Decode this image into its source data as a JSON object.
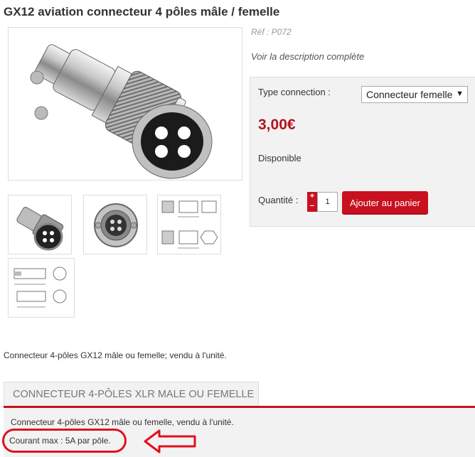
{
  "product": {
    "title": "GX12 aviation connecteur 4 pôles mâle / femelle",
    "ref": "Réf : P072",
    "description_link": "Voir la description complète"
  },
  "purchase": {
    "type_label": "Type connection :",
    "type_selected": "Connecteur femelle",
    "price": "3,00€",
    "availability": "Disponible",
    "quantity_label": "Quantité :",
    "quantity_value": "1",
    "plus": "+",
    "minus": "−",
    "add_to_cart": "Ajouter au panier"
  },
  "short_description": "Connecteur 4-pôles GX12 mâle ou femelle; vendu à l'unité.",
  "tabs": [
    {
      "label": "CONNECTEUR 4-PÔLES XLR MALE OU FEMELLE"
    }
  ],
  "tab_content": {
    "line1": "Connecteur 4-pôles GX12 mâle ou femelle, vendu à l'unité.",
    "line2": "Courant max : 5A par pôle."
  },
  "colors": {
    "accent": "#c8101e",
    "price": "#b8101e",
    "annotation": "#e01020"
  },
  "icons": {
    "select_arrow": "chevron-down-icon",
    "annotation_arrow": "left-arrow-icon"
  }
}
